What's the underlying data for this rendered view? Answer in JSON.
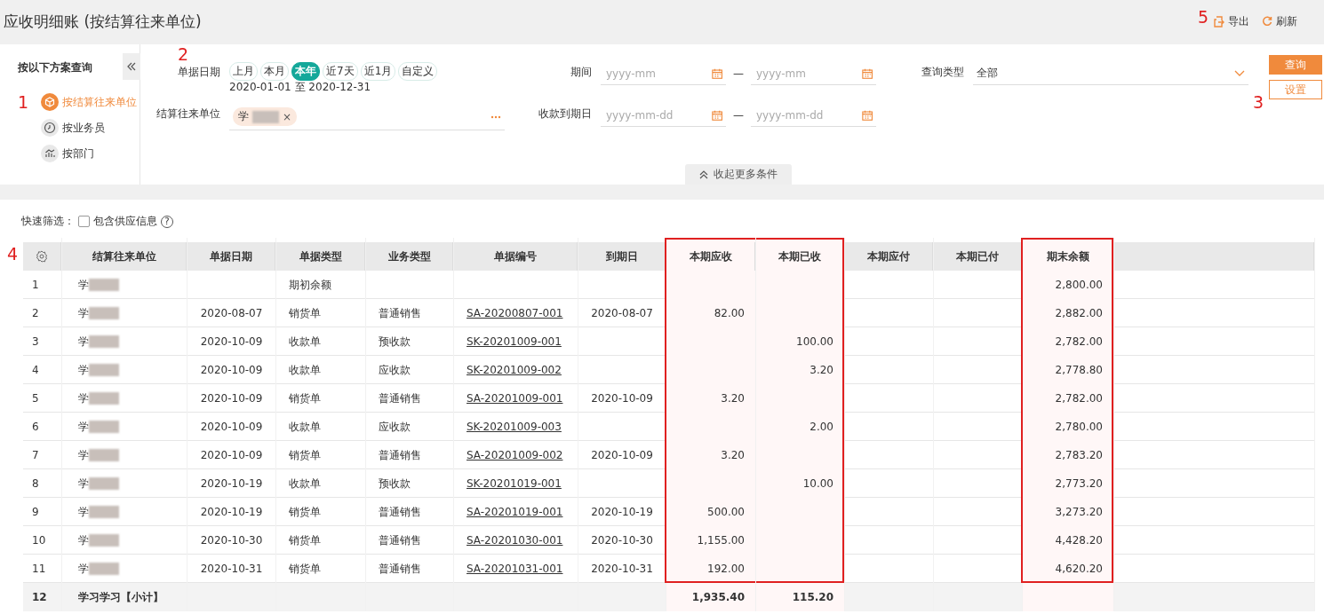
{
  "title": "应收明细账 (按结算往来单位)",
  "toolbar": {
    "annotation": "5",
    "buttons": [
      {
        "kind": "export",
        "label": "导出"
      },
      {
        "kind": "refresh",
        "label": "刷新"
      }
    ]
  },
  "sidebar": {
    "heading": "按以下方案查询",
    "annotation": "1",
    "items": [
      {
        "kind": "unit",
        "label": "按结算往来单位",
        "selected": true
      },
      {
        "kind": "clerk",
        "label": "按业务员",
        "selected": false
      },
      {
        "kind": "dept",
        "label": "按部门",
        "selected": false
      }
    ]
  },
  "filters": {
    "annotation": "2",
    "date": {
      "label": "单据日期",
      "presets": [
        {
          "label": "上月",
          "selected": false
        },
        {
          "label": "本月",
          "selected": false
        },
        {
          "label": "本年",
          "selected": true
        },
        {
          "label": "近7天",
          "selected": false
        },
        {
          "label": "近1月",
          "selected": false
        },
        {
          "label": "自定义",
          "selected": false
        }
      ],
      "range": "2020-01-01 至 2020-12-31"
    },
    "unit": {
      "label": "结算往来单位",
      "tag": "学",
      "remove": "×"
    },
    "period": {
      "label": "期间",
      "from_placeholder": "yyyy-mm",
      "dash": "—",
      "to_placeholder": "yyyy-mm"
    },
    "due": {
      "label": "收款到期日",
      "from_placeholder": "yyyy-mm-dd",
      "dash": "—",
      "to_placeholder": "yyyy-mm-dd"
    },
    "query_type": {
      "label": "查询类型",
      "value": "全部"
    },
    "collapse": "收起更多条件"
  },
  "actions": {
    "annotation": "3",
    "query": "查询",
    "settings": "设置"
  },
  "quick_filter": {
    "label": "快速筛选：",
    "checkbox": {
      "label": "包含供应信息",
      "checked": false
    },
    "help": "?"
  },
  "table": {
    "annotation": "4",
    "columns": [
      {
        "label": "结算往来单位",
        "highlighted": false
      },
      {
        "label": "单据日期",
        "highlighted": false
      },
      {
        "label": "单据类型",
        "highlighted": false
      },
      {
        "label": "业务类型",
        "highlighted": false
      },
      {
        "label": "单据编号",
        "highlighted": false
      },
      {
        "label": "到期日",
        "highlighted": false
      },
      {
        "label": "本期应收",
        "highlighted": true
      },
      {
        "label": "本期已收",
        "highlighted": true
      },
      {
        "label": "本期应付",
        "highlighted": false
      },
      {
        "label": "本期已付",
        "highlighted": false
      },
      {
        "label": "期末余额",
        "highlighted": true
      }
    ],
    "rows": [
      {
        "no": "1",
        "unit": "学",
        "doc_type": "期初余额",
        "balance": "2,800.00"
      },
      {
        "no": "2",
        "unit": "学",
        "date": "2020-08-07",
        "doc_type": "销货单",
        "biz_type": "普通销售",
        "doc_no": "SA-20200807-001",
        "due": "2020-08-07",
        "receivable": "82.00",
        "balance": "2,882.00"
      },
      {
        "no": "3",
        "unit": "学",
        "date": "2020-10-09",
        "doc_type": "收款单",
        "biz_type": "预收款",
        "doc_no": "SK-20201009-001",
        "received": "100.00",
        "balance": "2,782.00"
      },
      {
        "no": "4",
        "unit": "学",
        "date": "2020-10-09",
        "doc_type": "收款单",
        "biz_type": "应收款",
        "doc_no": "SK-20201009-002",
        "received": "3.20",
        "balance": "2,778.80"
      },
      {
        "no": "5",
        "unit": "学",
        "date": "2020-10-09",
        "doc_type": "销货单",
        "biz_type": "普通销售",
        "doc_no": "SA-20201009-001",
        "due": "2020-10-09",
        "receivable": "3.20",
        "balance": "2,782.00"
      },
      {
        "no": "6",
        "unit": "学",
        "date": "2020-10-09",
        "doc_type": "收款单",
        "biz_type": "应收款",
        "doc_no": "SK-20201009-003",
        "received": "2.00",
        "balance": "2,780.00"
      },
      {
        "no": "7",
        "unit": "学",
        "date": "2020-10-09",
        "doc_type": "销货单",
        "biz_type": "普通销售",
        "doc_no": "SA-20201009-002",
        "due": "2020-10-09",
        "receivable": "3.20",
        "balance": "2,783.20"
      },
      {
        "no": "8",
        "unit": "学",
        "date": "2020-10-19",
        "doc_type": "收款单",
        "biz_type": "预收款",
        "doc_no": "SK-20201019-001",
        "received": "10.00",
        "balance": "2,773.20"
      },
      {
        "no": "9",
        "unit": "学",
        "date": "2020-10-19",
        "doc_type": "销货单",
        "biz_type": "普通销售",
        "doc_no": "SA-20201019-001",
        "due": "2020-10-19",
        "receivable": "500.00",
        "balance": "3,273.20"
      },
      {
        "no": "10",
        "unit": "学",
        "date": "2020-10-30",
        "doc_type": "销货单",
        "biz_type": "普通销售",
        "doc_no": "SA-20201030-001",
        "due": "2020-10-30",
        "receivable": "1,155.00",
        "balance": "4,428.20"
      },
      {
        "no": "11",
        "unit": "学",
        "date": "2020-10-31",
        "doc_type": "销货单",
        "biz_type": "普通销售",
        "doc_no": "SA-20201031-001",
        "due": "2020-10-31",
        "receivable": "192.00",
        "balance": "4,620.20"
      }
    ],
    "subtotal": {
      "no": "12",
      "unit": "学习学习【小计】",
      "receivable": "1,935.40",
      "received": "115.20"
    }
  }
}
